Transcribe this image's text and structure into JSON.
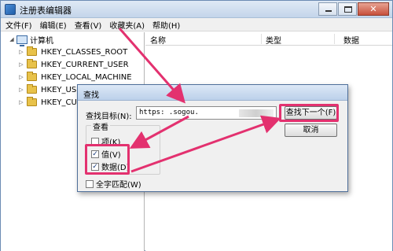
{
  "window": {
    "title": "注册表编辑器",
    "menu": [
      "文件(F)",
      "编辑(E)",
      "查看(V)",
      "收藏夹(A)",
      "帮助(H)"
    ]
  },
  "tree": {
    "root": "计算机",
    "items": [
      "HKEY_CLASSES_ROOT",
      "HKEY_CURRENT_USER",
      "HKEY_LOCAL_MACHINE",
      "HKEY_USERS",
      "HKEY_CU"
    ]
  },
  "list": {
    "columns": [
      "名称",
      "类型",
      "数据"
    ]
  },
  "find_dialog": {
    "title": "查找",
    "target_label": "查找目标(N):",
    "target_value": "https:      .sogou.",
    "find_next_label": "查找下一个(F)",
    "cancel_label": "取消",
    "look_at_label": "查看",
    "options": [
      {
        "label": "项(K)",
        "checked": false
      },
      {
        "label": "值(V)",
        "checked": true
      },
      {
        "label": "数据(D)",
        "checked": true
      }
    ],
    "whole_match_label": "全字匹配(W)",
    "whole_match_checked": false
  },
  "annotation_color": "#e3316f"
}
